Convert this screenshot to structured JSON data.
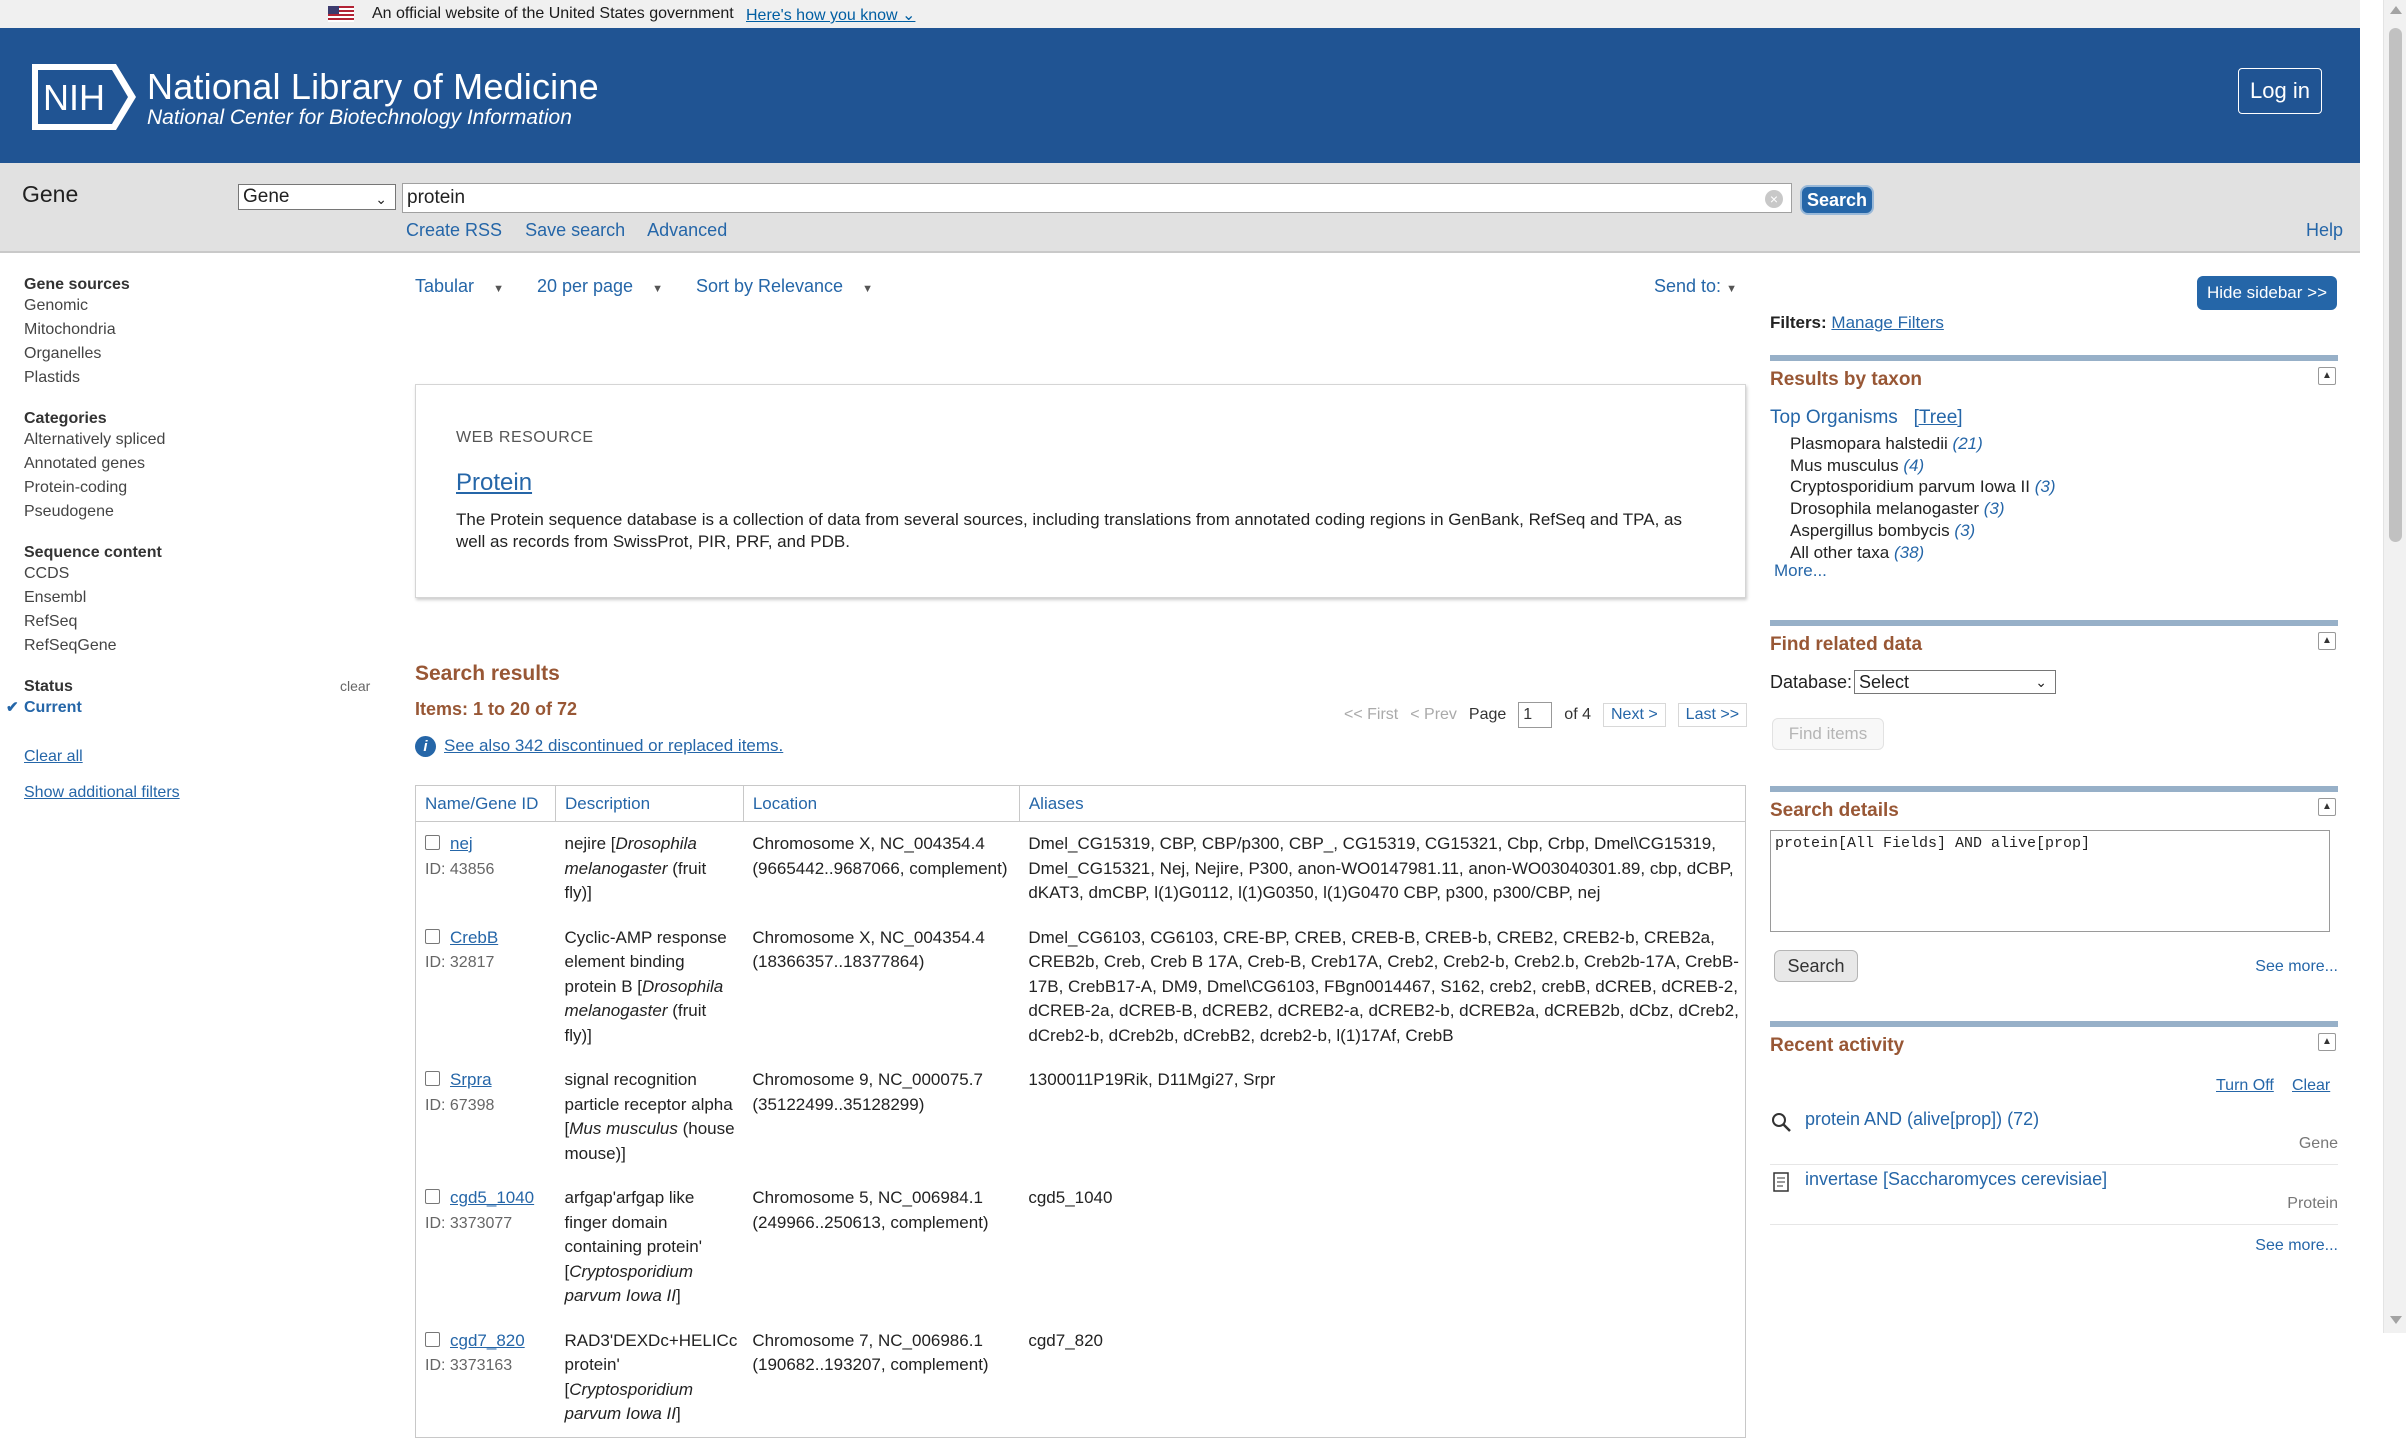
{
  "gov_banner": {
    "text": "An official website of the United States government",
    "link": "Here's how you know"
  },
  "header": {
    "logo_text": "NIH",
    "title": "National Library of Medicine",
    "subtitle": "National Center for Biotechnology Information",
    "login": "Log in"
  },
  "search": {
    "db_label": "Gene",
    "db_selected": "Gene",
    "query": "protein",
    "button": "Search",
    "links": [
      "Create RSS",
      "Save search",
      "Advanced"
    ],
    "help": "Help"
  },
  "left_sidebar": {
    "gene_sources": {
      "title": "Gene sources",
      "items": [
        "Genomic",
        "Mitochondria",
        "Organelles",
        "Plastids"
      ]
    },
    "categories": {
      "title": "Categories",
      "items": [
        "Alternatively spliced",
        "Annotated genes",
        "Protein-coding",
        "Pseudogene"
      ]
    },
    "sequence_content": {
      "title": "Sequence content",
      "items": [
        "CCDS",
        "Ensembl",
        "RefSeq",
        "RefSeqGene"
      ]
    },
    "status": {
      "title": "Status",
      "clear": "clear",
      "current": "Current"
    },
    "clear_all": "Clear all",
    "show_filters": "Show additional filters"
  },
  "display": {
    "format": "Tabular",
    "per_page": "20 per page",
    "sort": "Sort by Relevance",
    "send_to": "Send to:"
  },
  "web_resource": {
    "kicker": "WEB RESOURCE",
    "title": "Protein",
    "description": "The Protein sequence database is a collection of data from several sources, including translations from annotated coding regions in GenBank, RefSeq and TPA, as well as records from SwissProt, PIR, PRF, and PDB."
  },
  "results": {
    "heading": "Search results",
    "items": "Items: 1 to 20 of 72",
    "pager": {
      "first": "<< First",
      "prev": "< Prev",
      "page_label": "Page",
      "page": "1",
      "of": "of 4",
      "next": "Next >",
      "last": "Last >>"
    },
    "see_also": "See also 342 discontinued or replaced items.",
    "columns": [
      "Name/Gene ID",
      "Description",
      "Location",
      "Aliases"
    ],
    "rows": [
      {
        "name": "nej",
        "id": "ID: 43856",
        "desc_pre": "nejire [",
        "desc_org": "Drosophila melanogaster",
        "desc_post": " (fruit fly)]",
        "location": "Chromosome X, NC_004354.4 (9665442..9687066, complement)",
        "aliases": "Dmel_CG15319, CBP, CBP/p300, CBP_, CG15319, CG15321, Cbp, Crbp, Dmel\\CG15319, Dmel_CG15321, Nej, Nejire, P300, anon-WO0147981.11, anon-WO03040301.89, cbp, dCBP, dKAT3, dmCBP, l(1)G0112, l(1)G0350, l(1)G0470 CBP, p300, p300/CBP, nej"
      },
      {
        "name": "CrebB",
        "id": "ID: 32817",
        "desc_pre": "Cyclic-AMP response element binding protein B [",
        "desc_org": "Drosophila melanogaster",
        "desc_post": " (fruit fly)]",
        "location": "Chromosome X, NC_004354.4 (18366357..18377864)",
        "aliases": "Dmel_CG6103, CG6103, CRE-BP, CREB, CREB-B, CREB-b, CREB2, CREB2-b, CREB2a, CREB2b, Creb, Creb B 17A, Creb-B, Creb17A, Creb2, Creb2-b, Creb2.b, Creb2b-17A, CrebB-17B, CrebB17-A, DM9, Dmel\\CG6103, FBgn0014467, S162, creb2, crebB, dCREB, dCREB-2, dCREB-2a, dCREB-B, dCREB2, dCREB2-a, dCREB2-b, dCREB2a, dCREB2b, dCbz, dCreb2, dCreb2-b, dCreb2b, dCrebB2, dcreb2-b, l(1)17Af, CrebB"
      },
      {
        "name": "Srpra",
        "id": "ID: 67398",
        "desc_pre": "signal recognition particle receptor alpha [",
        "desc_org": "Mus musculus",
        "desc_post": " (house mouse)]",
        "location": "Chromosome 9, NC_000075.7 (35122499..35128299)",
        "aliases": "1300011P19Rik, D11Mgi27, Srpr"
      },
      {
        "name": "cgd5_1040",
        "id": "ID: 3373077",
        "desc_pre": "arfgap'arfgap like finger domain containing protein' [",
        "desc_org": "Cryptosporidium parvum Iowa II",
        "desc_post": "]",
        "location": "Chromosome 5, NC_006984.1 (249966..250613, complement)",
        "aliases": "cgd5_1040"
      },
      {
        "name": "cgd7_820",
        "id": "ID: 3373163",
        "desc_pre": "RAD3'DEXDc+HELICc protein' [",
        "desc_org": "Cryptosporidium parvum Iowa II",
        "desc_post": "]",
        "location": "Chromosome 7, NC_006986.1 (190682..193207, complement)",
        "aliases": "cgd7_820"
      }
    ]
  },
  "right_sidebar": {
    "hide": "Hide sidebar >>",
    "filters_label": "Filters:",
    "manage_filters": "Manage Filters",
    "taxon": {
      "title": "Results by taxon",
      "top_orgs": "Top Organisms",
      "tree": "[Tree]",
      "list": [
        {
          "name": "Plasmopara halstedii",
          "count": "(21)"
        },
        {
          "name": "Mus musculus",
          "count": "(4)"
        },
        {
          "name": "Cryptosporidium parvum Iowa II",
          "count": "(3)"
        },
        {
          "name": "Drosophila melanogaster",
          "count": "(3)"
        },
        {
          "name": "Aspergillus bombycis",
          "count": "(3)"
        },
        {
          "name": "All other taxa",
          "count": "(38)"
        }
      ],
      "more": "More..."
    },
    "related": {
      "title": "Find related data",
      "db_label": "Database:",
      "db_selected": "Select",
      "button": "Find items"
    },
    "details": {
      "title": "Search details",
      "query": "protein[All Fields] AND alive[prop]",
      "button": "Search",
      "see_more": "See more..."
    },
    "recent": {
      "title": "Recent activity",
      "turn_off": "Turn Off",
      "clear": "Clear",
      "items": [
        {
          "text": "protein AND (alive[prop]) (72)",
          "db": "Gene"
        },
        {
          "text": "invertase [Saccharomyces cerevisiae]",
          "db": "Protein"
        }
      ],
      "see_more": "See more..."
    }
  }
}
